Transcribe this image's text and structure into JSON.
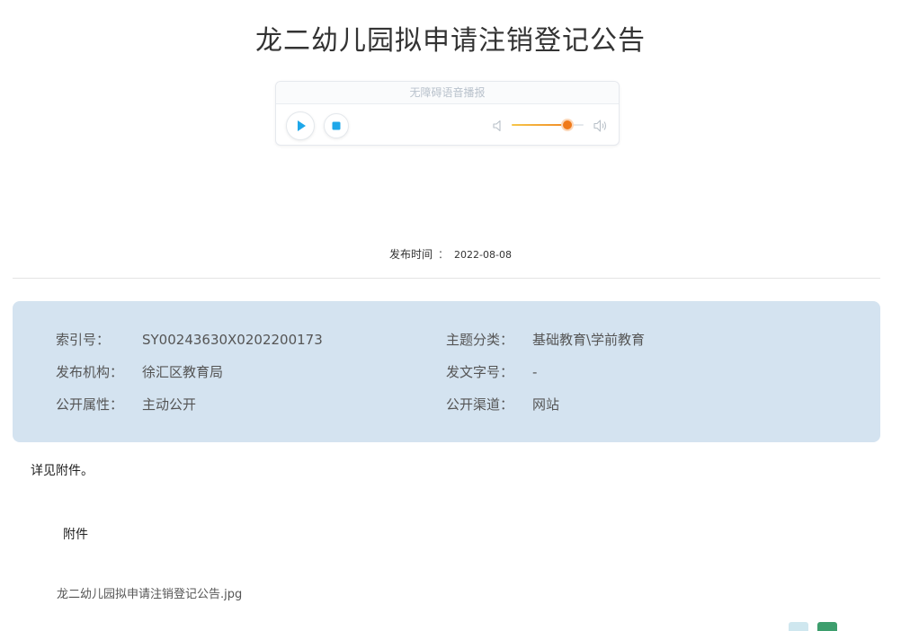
{
  "page": {
    "title": "龙二幼儿园拟申请注销登记公告"
  },
  "player": {
    "label": "无障碍语音播报",
    "volume_percent": 78,
    "accent_color": "#1ea7e9",
    "volume_color": "#f07a1a"
  },
  "meta": {
    "publish_label": "发布时间",
    "separator": "：",
    "publish_date": "2022-08-08"
  },
  "info": {
    "left": [
      {
        "label": "索引号：",
        "value": "SY00243630X0202200173"
      },
      {
        "label": "发布机构：",
        "value": "徐汇区教育局"
      },
      {
        "label": "公开属性：",
        "value": "主动公开"
      }
    ],
    "right": [
      {
        "label": "主题分类：",
        "value": "基础教育\\学前教育"
      },
      {
        "label": "发文字号：",
        "value": "-"
      },
      {
        "label": "公开渠道：",
        "value": "网站"
      }
    ]
  },
  "content": {
    "body": "详见附件。",
    "attachment_heading": "附件",
    "attachment_file": "龙二幼儿园拟申请注销登记公告.jpg"
  },
  "colors": {
    "info_box_bg": "#d4e3f0",
    "corner_left": "#cfe7ef",
    "corner_right": "#3d9e6d"
  }
}
